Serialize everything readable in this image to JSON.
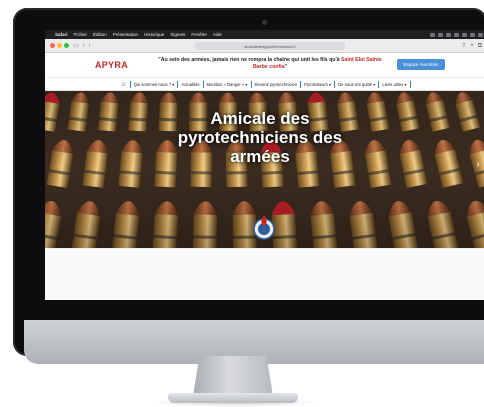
{
  "macos_menubar": {
    "items": [
      "Safari",
      "Fichier",
      "Édition",
      "Présentation",
      "Historique",
      "Signets",
      "Fenêtre",
      "Aide"
    ]
  },
  "browser": {
    "address": "amicaledespyrotechniciens.fr",
    "back_icon": "chevron-left-icon",
    "forward_icon": "chevron-right-icon",
    "share_icon": "share-icon",
    "new_tab_icon": "plus-icon"
  },
  "site": {
    "logo": "APYRA",
    "tagline_main": "\"Au sein des armées, jamais rien ne rompra la chaîne qui unit les fils qu'à ",
    "tagline_accent": "Saint Eloi Sainte Barbe confia",
    "tagline_end": "\"",
    "member_button": "Espace membres",
    "nav": [
      "Qui sommes-nous ? ▾",
      "Actualités",
      "Munition « Danger » ▾",
      "Devenir pyrotechnicien",
      "Pyrotraiteurs ▾",
      "De nous ont quitté ▾",
      "Liens utiles ▾"
    ],
    "hero_title": "Amicale des pyrotechniciens des armées"
  },
  "colors": {
    "accent_red": "#c62828",
    "button_blue": "#4a90d9",
    "nav_divider": "#3b82c4"
  }
}
